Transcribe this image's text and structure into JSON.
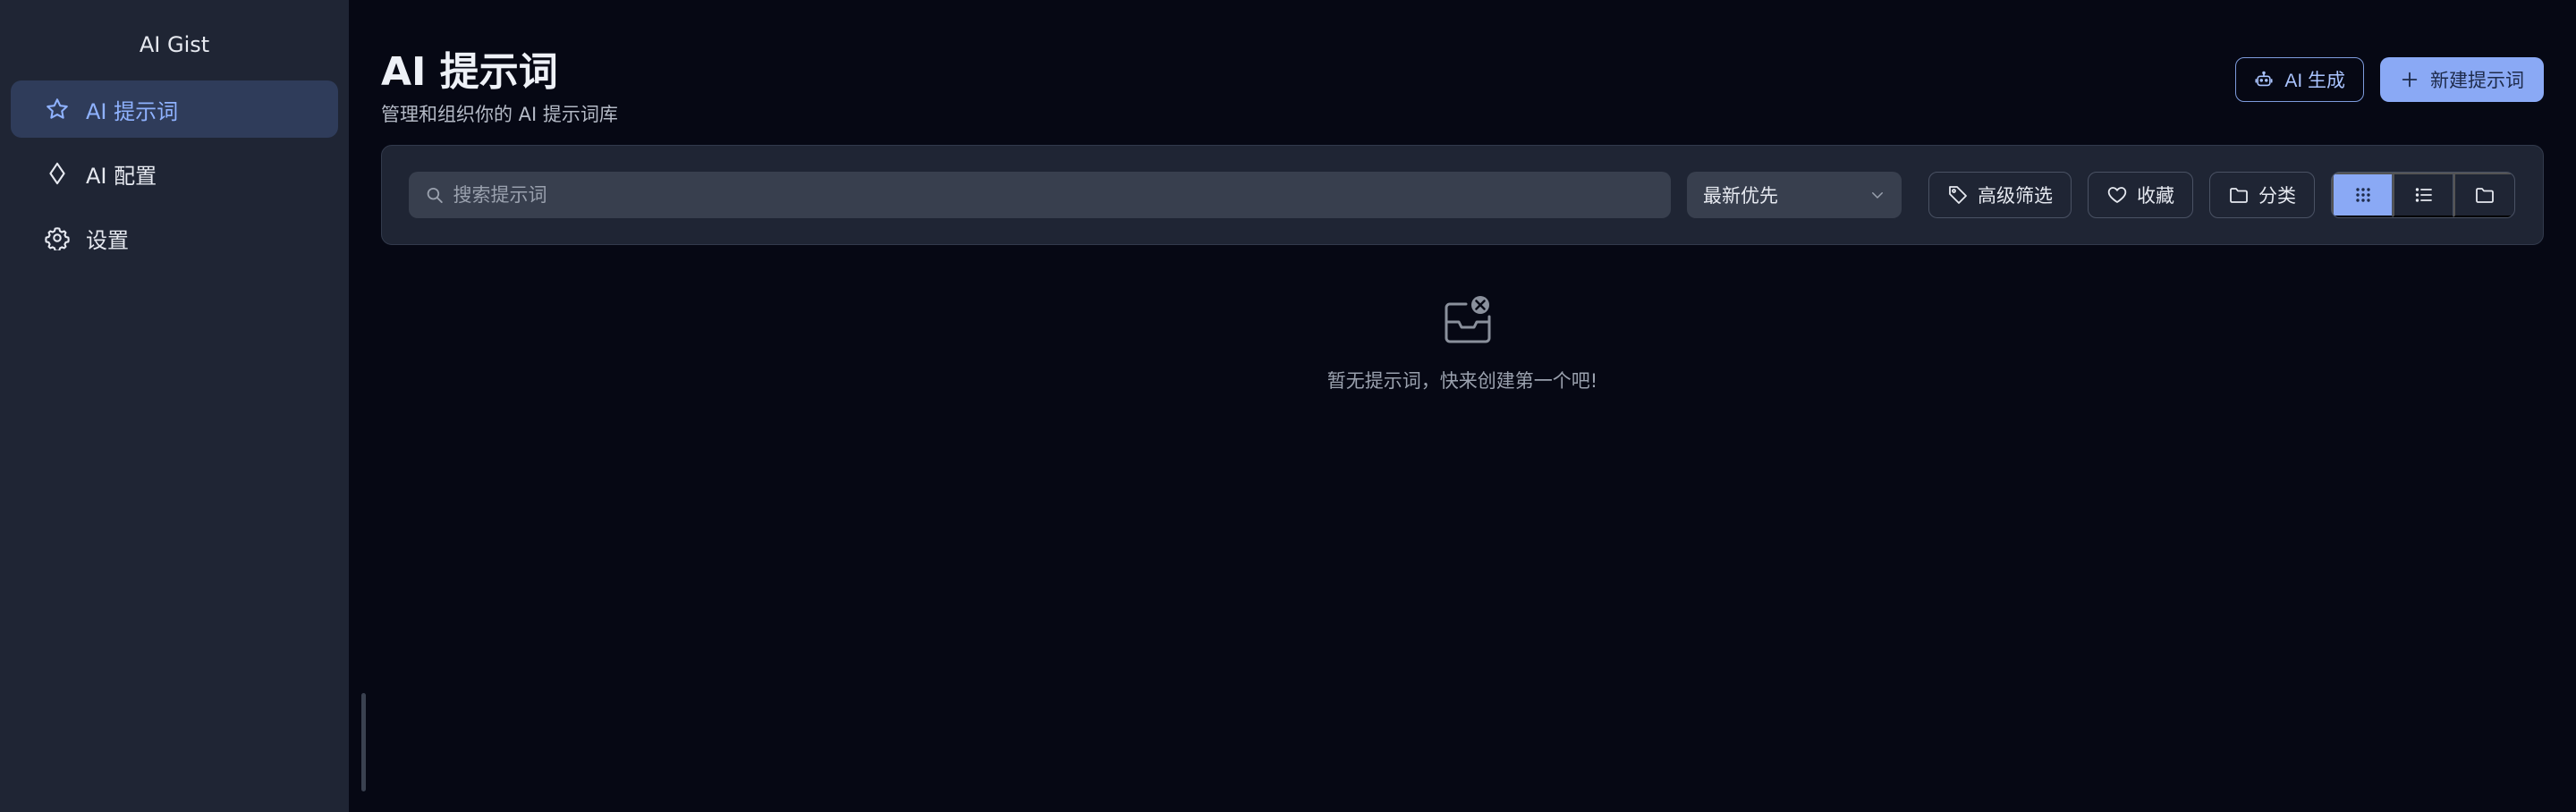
{
  "sidebar": {
    "app_title": "AI Gist",
    "items": [
      {
        "label": "AI 提示词",
        "icon": "star-icon",
        "active": true
      },
      {
        "label": "AI 配置",
        "icon": "diamond-icon",
        "active": false
      },
      {
        "label": "设置",
        "icon": "gear-icon",
        "active": false
      }
    ]
  },
  "header": {
    "title": "AI 提示词",
    "subtitle": "管理和组织你的 AI 提示词库",
    "ai_generate_label": "AI 生成",
    "new_prompt_label": "新建提示词"
  },
  "toolbar": {
    "search_placeholder": "搜索提示词",
    "sort_value": "最新优先",
    "advanced_filter_label": "高级筛选",
    "favorites_label": "收藏",
    "category_label": "分类",
    "views": [
      "grid-view",
      "list-view",
      "folder-view"
    ],
    "active_view": "grid-view"
  },
  "empty_state": {
    "message": "暂无提示词，快来创建第一个吧!"
  },
  "colors": {
    "background": "#060814",
    "sidebar": "#1f2534",
    "accent": "#8aa9f5",
    "active_item": "#2f3c5a"
  }
}
